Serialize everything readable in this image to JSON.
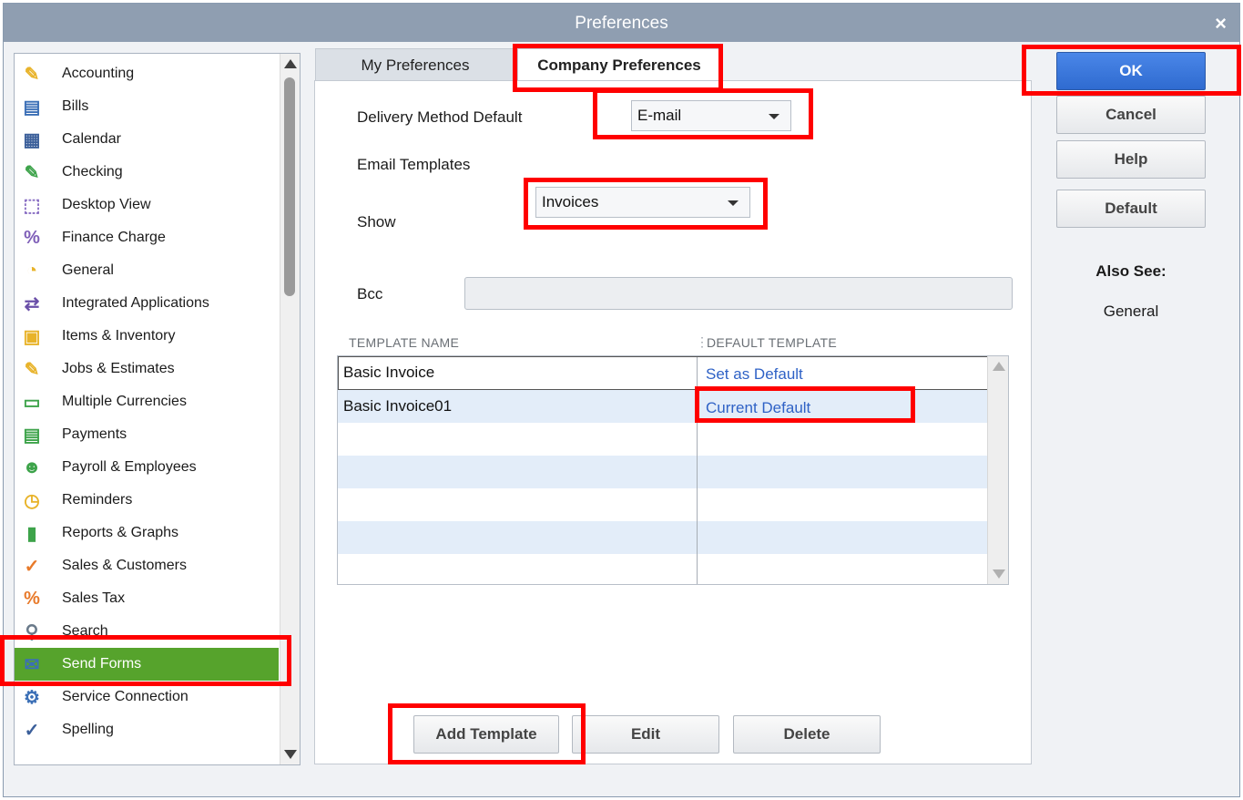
{
  "window": {
    "title": "Preferences",
    "close_glyph": "×"
  },
  "categories": [
    {
      "label": "Accounting",
      "icon": "accounting-icon",
      "glyph": "✎",
      "color": "#e8b32a"
    },
    {
      "label": "Bills",
      "icon": "bills-icon",
      "glyph": "▤",
      "color": "#3b6fb6"
    },
    {
      "label": "Calendar",
      "icon": "calendar-icon",
      "glyph": "▦",
      "color": "#3b5f9a"
    },
    {
      "label": "Checking",
      "icon": "checking-icon",
      "glyph": "✎",
      "color": "#3da34a"
    },
    {
      "label": "Desktop View",
      "icon": "desktop-view-icon",
      "glyph": "⬚",
      "color": "#8a6fc4"
    },
    {
      "label": "Finance Charge",
      "icon": "finance-charge-icon",
      "glyph": "%",
      "color": "#7f5fb8"
    },
    {
      "label": "General",
      "icon": "general-icon",
      "glyph": "◔",
      "color": "#e8b32a"
    },
    {
      "label": "Integrated Applications",
      "icon": "integrated-applications-icon",
      "glyph": "⇄",
      "color": "#6a4fa8"
    },
    {
      "label": "Items & Inventory",
      "icon": "items-inventory-icon",
      "glyph": "▣",
      "color": "#e8b32a"
    },
    {
      "label": "Jobs & Estimates",
      "icon": "jobs-estimates-icon",
      "glyph": "✎",
      "color": "#e8b32a"
    },
    {
      "label": "Multiple Currencies",
      "icon": "multiple-currencies-icon",
      "glyph": "▭",
      "color": "#3da34a"
    },
    {
      "label": "Payments",
      "icon": "payments-icon",
      "glyph": "▤",
      "color": "#3da34a"
    },
    {
      "label": "Payroll & Employees",
      "icon": "payroll-employees-icon",
      "glyph": "☻",
      "color": "#3da34a"
    },
    {
      "label": "Reminders",
      "icon": "reminders-icon",
      "glyph": "◷",
      "color": "#e8b32a"
    },
    {
      "label": "Reports & Graphs",
      "icon": "reports-graphs-icon",
      "glyph": "▮",
      "color": "#3da34a"
    },
    {
      "label": "Sales & Customers",
      "icon": "sales-customers-icon",
      "glyph": "✓",
      "color": "#e87a2a"
    },
    {
      "label": "Sales Tax",
      "icon": "sales-tax-icon",
      "glyph": "%",
      "color": "#e87a2a"
    },
    {
      "label": "Search",
      "icon": "search-icon",
      "glyph": "⚲",
      "color": "#6a7a8a"
    },
    {
      "label": "Send Forms",
      "icon": "send-forms-icon",
      "glyph": "✉",
      "color": "#3b6fb6",
      "selected": true
    },
    {
      "label": "Service Connection",
      "icon": "service-connection-icon",
      "glyph": "⚙",
      "color": "#3b6fb6"
    },
    {
      "label": "Spelling",
      "icon": "spelling-icon",
      "glyph": "✓",
      "color": "#3b5f9a"
    }
  ],
  "tabs": {
    "my": "My Preferences",
    "company": "Company Preferences"
  },
  "form": {
    "delivery_label": "Delivery Method Default",
    "delivery_value": "E-mail",
    "email_templates_label": "Email Templates",
    "show_label": "Show",
    "show_value": "Invoices",
    "bcc_label": "Bcc",
    "bcc_value": ""
  },
  "templates": {
    "columns": [
      "TEMPLATE NAME",
      "DEFAULT TEMPLATE"
    ],
    "rows": [
      {
        "name": "Basic Invoice",
        "default": "Set as Default"
      },
      {
        "name": "Basic Invoice01",
        "default": "Current Default"
      }
    ]
  },
  "buttons": {
    "add_template": "Add Template",
    "edit": "Edit",
    "delete": "Delete",
    "ok": "OK",
    "cancel": "Cancel",
    "help": "Help",
    "default": "Default"
  },
  "also_see": {
    "heading": "Also See:",
    "link": "General"
  },
  "colors": {
    "selected_bg": "#56a32c",
    "link": "#2f62c6",
    "ok_bg": "#2f6bd0",
    "highlight": "#ff0000"
  }
}
